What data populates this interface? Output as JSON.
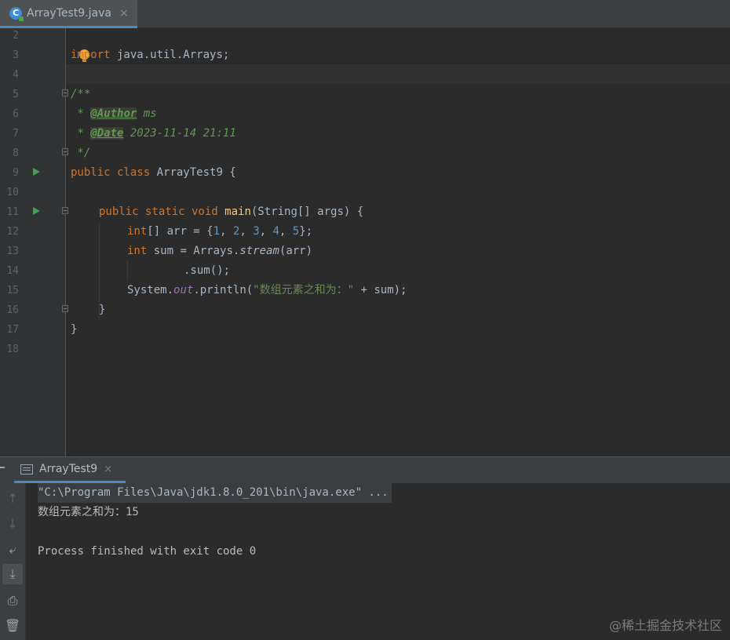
{
  "editor_tab": {
    "label": "ArrayTest9.java",
    "close": "×",
    "icon": "java-class-icon"
  },
  "line_numbers": [
    "2",
    "3",
    "4",
    "5",
    "6",
    "7",
    "8",
    "9",
    "10",
    "11",
    "12",
    "13",
    "14",
    "15",
    "16",
    "17",
    "18"
  ],
  "code": {
    "l3_kw": "import",
    "l3_rest": " java.util.Arrays;",
    "l5": "/**",
    "l6_star": " * ",
    "l6_tag": "@Author",
    "l6_val": " ms",
    "l7_star": " * ",
    "l7_tag": "@Date",
    "l7_val": " 2023-11-14 21:11",
    "l8": " */",
    "l9_kw": "public class",
    "l9_rest": " ArrayTest9 {",
    "l11_kw": "public static void",
    "l11_method": "main",
    "l11_rest": "(String[] args) {",
    "l12_kw": "int",
    "l12_a": "[] arr = {",
    "l12_n1": "1",
    "l12_n2": "2",
    "l12_n3": "3",
    "l12_n4": "4",
    "l12_n5": "5",
    "l12_end": "};",
    "l13_kw": "int",
    "l13_a": " sum = Arrays.",
    "l13_m": "stream",
    "l13_b": "(arr)",
    "l14": ".sum();",
    "l15_a": "System.",
    "l15_field": "out",
    "l15_b": ".println(",
    "l15_str": "\"数组元素之和为：\"",
    "l15_c": " + sum);",
    "l16": "}",
    "l17": "}"
  },
  "run_panel": {
    "tab_label": "ArrayTest9",
    "close": "×"
  },
  "console": {
    "cmd": "\"C:\\Program Files\\Java\\jdk1.8.0_201\\bin\\java.exe\" ...",
    "output": "数组元素之和为：15",
    "finished": "Process finished with exit code 0"
  },
  "side_buttons": {
    "up": "↑",
    "down": "↓",
    "wrap": "⤶",
    "scroll_end": "⤓",
    "print": "⎙",
    "trash": "🗑"
  },
  "watermark": "@稀土掘金技术社区",
  "colors": {
    "accent": "#4a88c7",
    "keyword": "#cc7832",
    "number": "#6897bb",
    "string": "#6a8759",
    "doc": "#629755",
    "method": "#ffc66d",
    "field": "#9876aa"
  }
}
